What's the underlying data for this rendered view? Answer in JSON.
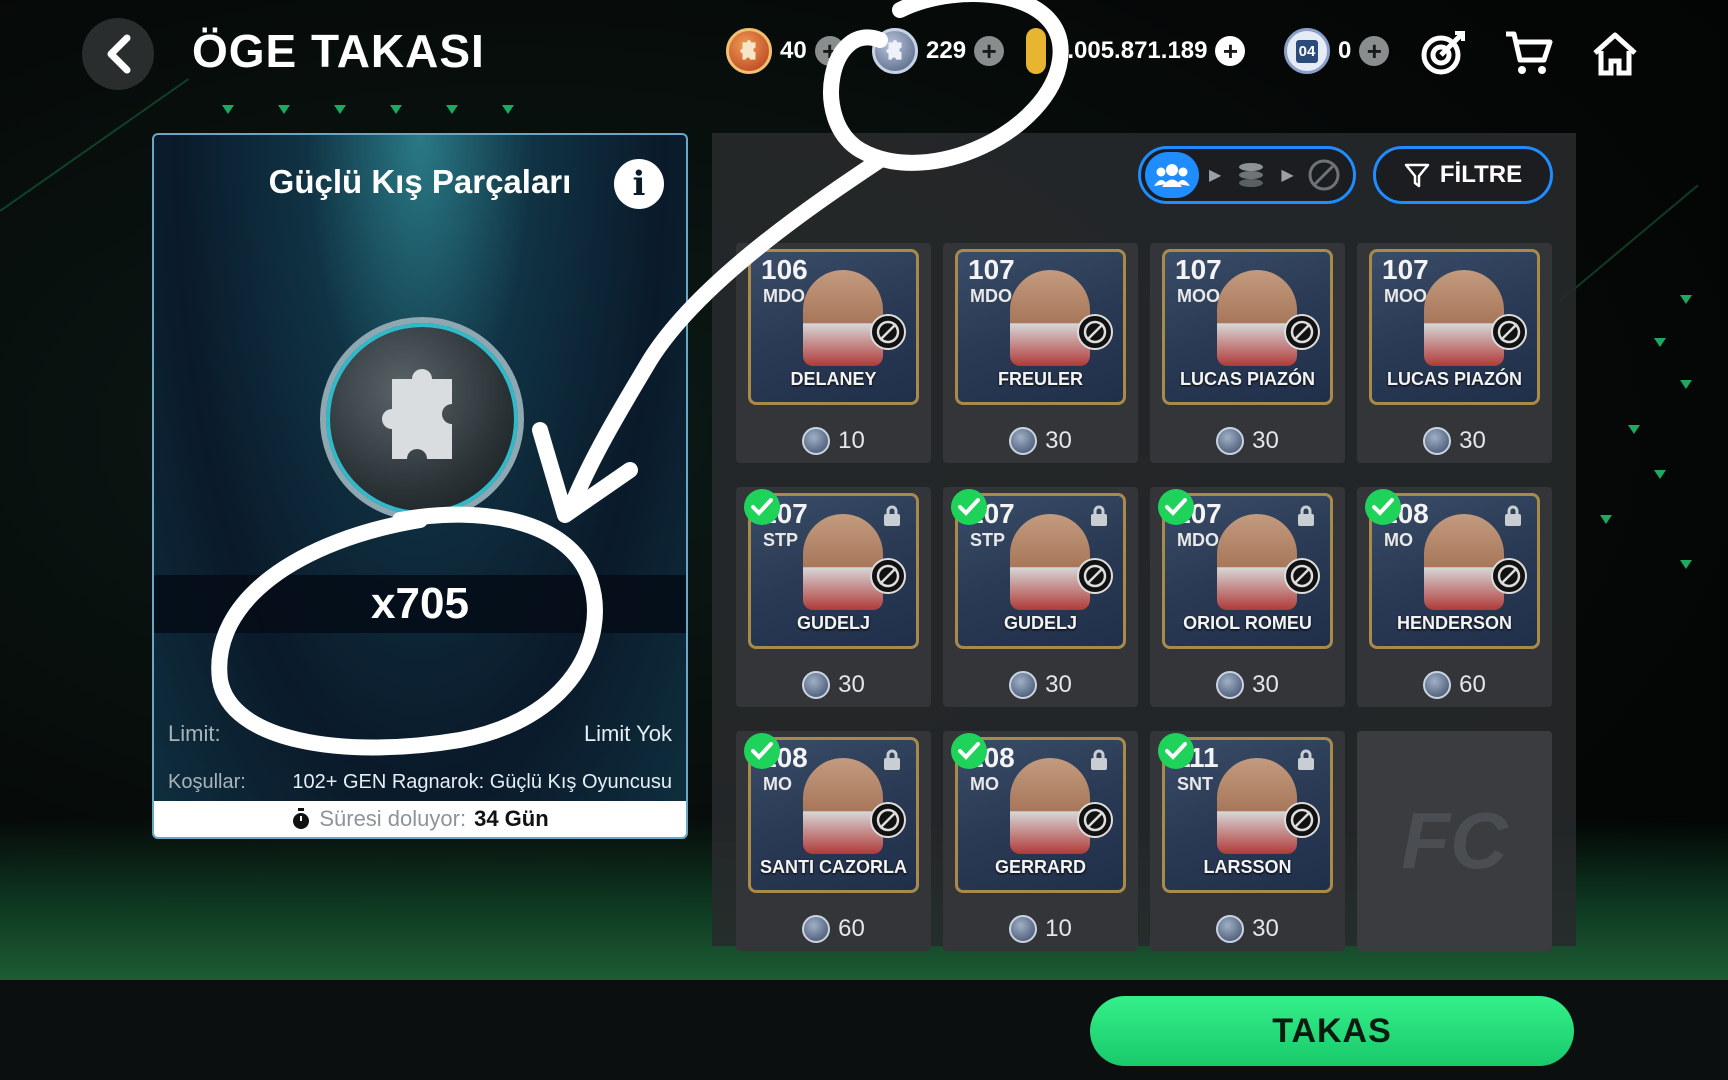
{
  "header": {
    "title": "ÖGE TAKASI",
    "currencies": [
      {
        "name": "orange-token",
        "value": "40",
        "color": "#d8552a"
      },
      {
        "name": "silver-piece",
        "value": "229",
        "color": "#7a8aa8"
      },
      {
        "name": "gold-coin",
        "value": "1.005.871.189",
        "color": "#e8b530"
      },
      {
        "name": "badge-04",
        "value": "0",
        "badge": "04",
        "color": "#2c4a7a"
      }
    ]
  },
  "panel": {
    "title": "Güçlü Kış Parçaları",
    "quantity": "x705",
    "limit_label": "Limit:",
    "limit_value": "Limit Yok",
    "cond_label": "Koşullar:",
    "cond_value": "102+ GEN Ragnarok: Güçlü Kış Oyuncusu",
    "expires_label": "Süresi doluyor:",
    "expires_value": "34 Gün"
  },
  "toolbar": {
    "filter_label": "FİLTRE"
  },
  "players": [
    {
      "rating": "106",
      "pos": "MDO",
      "name": "DELANEY",
      "cost": "10",
      "checked": false
    },
    {
      "rating": "107",
      "pos": "MDO",
      "name": "FREULER",
      "cost": "30",
      "checked": false
    },
    {
      "rating": "107",
      "pos": "MOO",
      "name": "LUCAS PIAZÓN",
      "cost": "30",
      "checked": false
    },
    {
      "rating": "107",
      "pos": "MOO",
      "name": "LUCAS PIAZÓN",
      "cost": "30",
      "checked": false
    },
    {
      "rating": "107",
      "pos": "STP",
      "name": "GUDELJ",
      "cost": "30",
      "checked": true
    },
    {
      "rating": "107",
      "pos": "STP",
      "name": "GUDELJ",
      "cost": "30",
      "checked": true
    },
    {
      "rating": "107",
      "pos": "MDO",
      "name": "ORIOL ROMEU",
      "cost": "30",
      "checked": true
    },
    {
      "rating": "108",
      "pos": "MO",
      "name": "HENDERSON",
      "cost": "60",
      "checked": true
    },
    {
      "rating": "108",
      "pos": "MO",
      "name": "SANTI CAZORLA",
      "cost": "60",
      "checked": true
    },
    {
      "rating": "108",
      "pos": "MO",
      "name": "GERRARD",
      "cost": "10",
      "checked": true
    },
    {
      "rating": "111",
      "pos": "SNT",
      "name": "LARSSON",
      "cost": "30",
      "checked": true
    }
  ],
  "action": {
    "takas_label": "TAKAS"
  },
  "colors": {
    "accent_blue": "#1f8cff",
    "takas_green": "#1fd35a"
  }
}
